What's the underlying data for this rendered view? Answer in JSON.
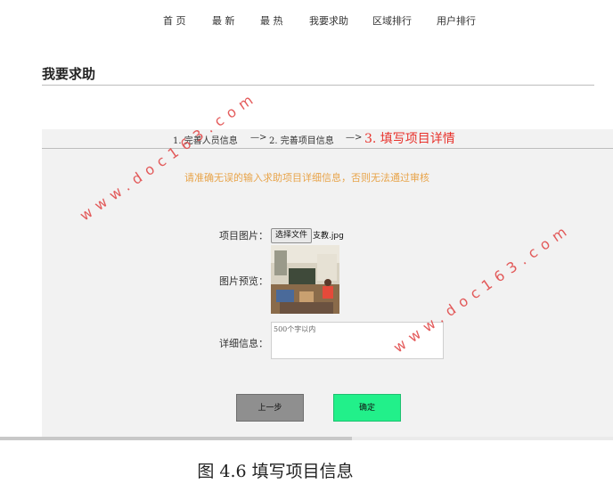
{
  "nav": {
    "items": [
      "首 页",
      "最 新",
      "最 热",
      "我要求助",
      "区域排行",
      "用户排行"
    ]
  },
  "page": {
    "title": "我要求助"
  },
  "steps": {
    "step1": "1. 完善人员信息",
    "arrow1": "—>",
    "step2": "2. 完善项目信息",
    "arrow2": "—>",
    "step3": "3. 填写项目详情"
  },
  "notice": "请准确无误的输入求助项目详细信息，否则无法通过审核",
  "form": {
    "image_label": "项目图片：",
    "choose_file_label": "选择文件",
    "file_name": "支教.jpg",
    "preview_label": "图片预览：",
    "detail_label": "详细信息：",
    "detail_placeholder": "500个字以内"
  },
  "buttons": {
    "prev": "上一步",
    "confirm": "确定"
  },
  "caption": "图 4.6  填写项目信息",
  "watermark": "www.doc163.com"
}
